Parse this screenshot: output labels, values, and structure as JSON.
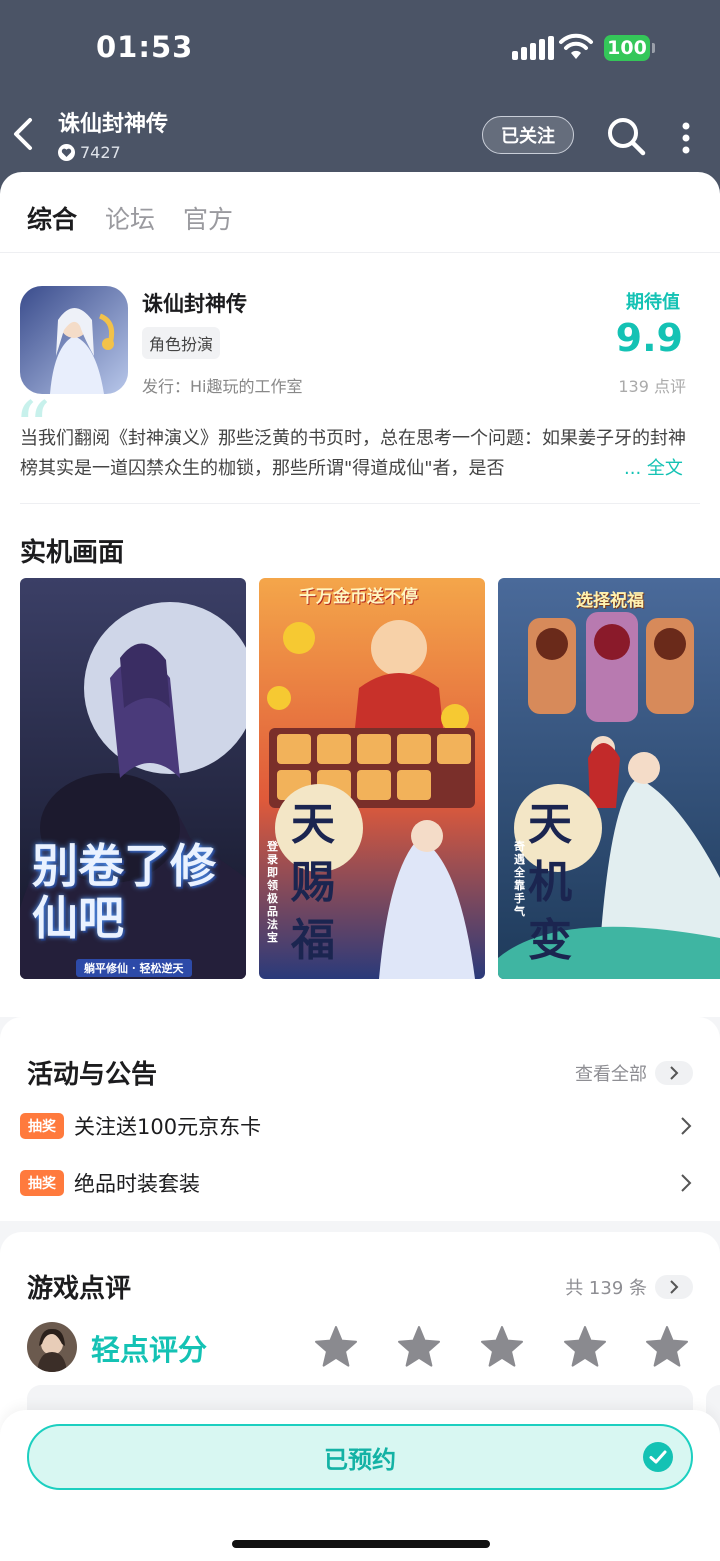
{
  "status_bar": {
    "time": "01:53",
    "battery": "100"
  },
  "nav": {
    "title": "诛仙封神传",
    "followers": "7427",
    "follow_label": "已关注"
  },
  "tabs": [
    {
      "label": "综合"
    },
    {
      "label": "论坛"
    },
    {
      "label": "官方"
    }
  ],
  "game": {
    "title": "诛仙封神传",
    "genre": "角色扮演",
    "publisher": "发行：Hi趣玩的工作室",
    "expect_label": "期待值",
    "expect_score": "9.9",
    "review_count": "139 点评",
    "description": "当我们翻阅《封神演义》那些泛黄的书页时，总在思考一个问题：如果姜子牙的封神榜其实是一道囚禁众生的枷锁，那些所谓\"得道成仙\"者，是否",
    "more_label": "... 全文"
  },
  "screenshots": {
    "title": "实机画面",
    "items": [
      {
        "headline": "别卷了修仙吧",
        "sub": "躺平修仙 · 轻松逆天"
      },
      {
        "headline": "千万金币送不停",
        "big": "天赐福",
        "side": "登录即领极品法宝"
      },
      {
        "headline": "选择祝福",
        "big": "天机变",
        "side": "奇遇全靠手气"
      }
    ]
  },
  "activities": {
    "title": "活动与公告",
    "see_all": "查看全部",
    "items": [
      {
        "tag": "抽奖",
        "text": "关注送100元京东卡"
      },
      {
        "tag": "抽奖",
        "text": "绝品时装套装"
      }
    ]
  },
  "reviews": {
    "title": "游戏点评",
    "total": "共 139 条",
    "rate_label": "轻点评分",
    "rating": 0,
    "max_rating": 5
  },
  "bottom": {
    "reserved_label": "已预约"
  },
  "colors": {
    "accent": "#14c2b4",
    "header_bg": "#4b5466",
    "lottery_tag": "#ff7a3d",
    "battery": "#34c759"
  }
}
